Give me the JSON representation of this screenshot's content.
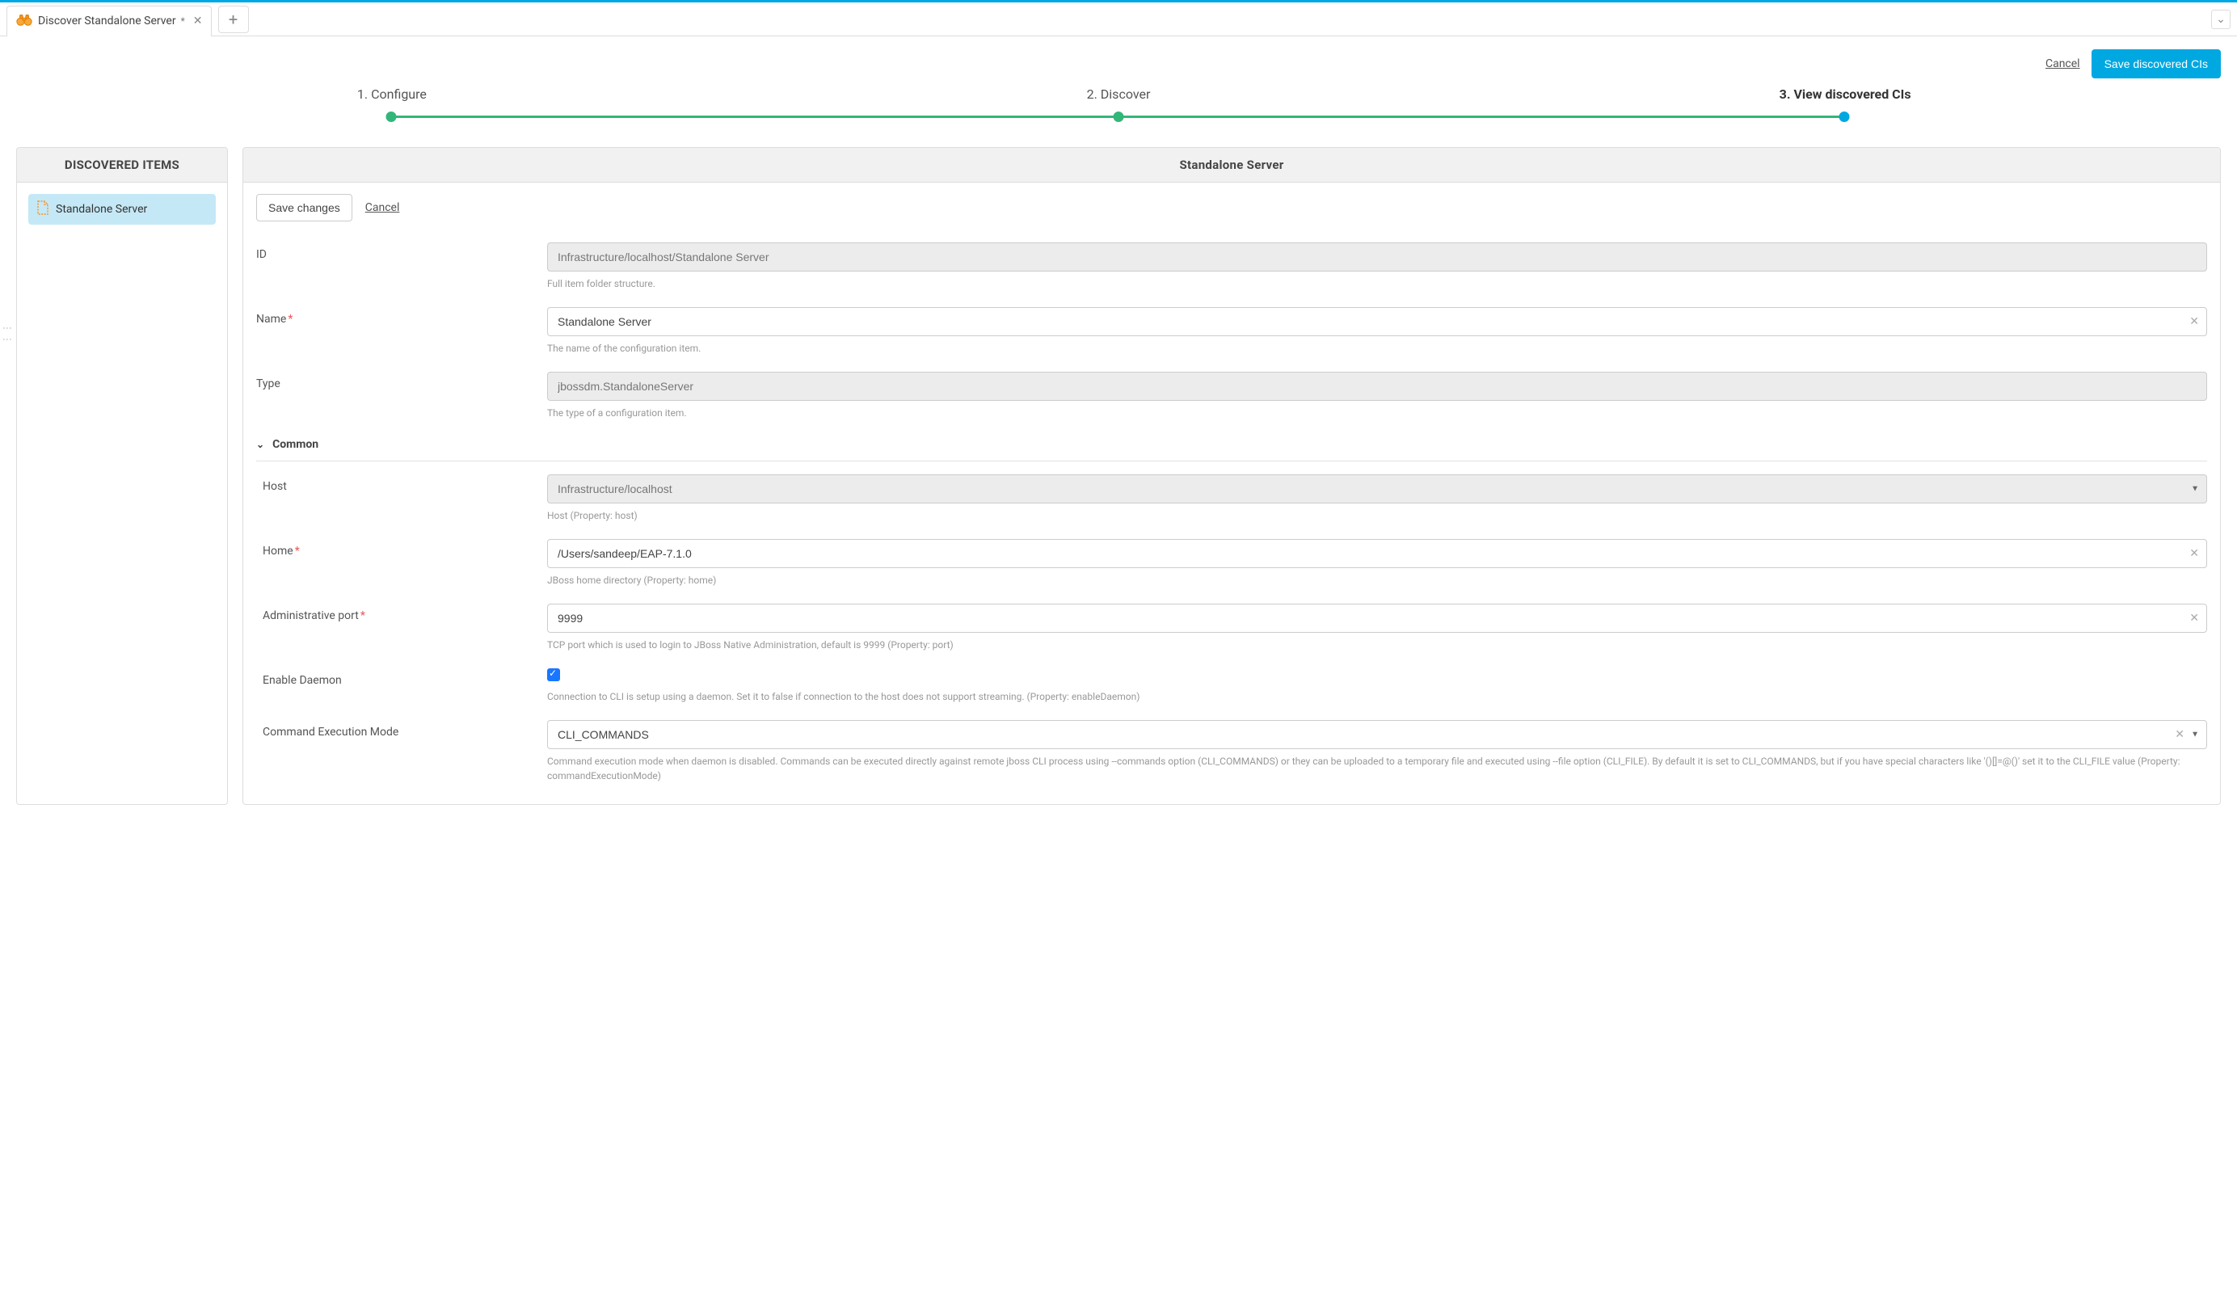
{
  "tab": {
    "title": "Discover Standalone Server",
    "dirty": "*"
  },
  "header": {
    "cancel": "Cancel",
    "save": "Save discovered CIs"
  },
  "stepper": {
    "step1": "1. Configure",
    "step2": "2. Discover",
    "step3": "3. View discovered CIs"
  },
  "sidebar": {
    "title": "DISCOVERED ITEMS",
    "item": "Standalone Server"
  },
  "panel": {
    "title": "Standalone Server",
    "save_changes": "Save changes",
    "cancel": "Cancel"
  },
  "form": {
    "id": {
      "label": "ID",
      "value": "Infrastructure/localhost/Standalone Server",
      "help": "Full item folder structure."
    },
    "name": {
      "label": "Name",
      "value": "Standalone Server",
      "help": "The name of the configuration item."
    },
    "type": {
      "label": "Type",
      "value": "jbossdm.StandaloneServer",
      "help": "The type of a configuration item."
    },
    "section_common": "Common",
    "host": {
      "label": "Host",
      "value": "Infrastructure/localhost",
      "help": "Host (Property: host)"
    },
    "home": {
      "label": "Home",
      "value": "/Users/sandeep/EAP-7.1.0",
      "help": "JBoss home directory (Property: home)"
    },
    "port": {
      "label": "Administrative port",
      "value": "9999",
      "help": "TCP port which is used to login to JBoss Native Administration, default is 9999 (Property: port)"
    },
    "daemon": {
      "label": "Enable Daemon",
      "help": "Connection to CLI is setup using a daemon. Set it to false if connection to the host does not support streaming. (Property: enableDaemon)"
    },
    "cmdmode": {
      "label": "Command Execution Mode",
      "value": "CLI_COMMANDS",
      "help": "Command execution mode when daemon is disabled. Commands can be executed directly against remote jboss CLI process using --commands option (CLI_COMMANDS) or they can be uploaded to a temporary file and executed using --file option (CLI_FILE). By default it is set to CLI_COMMANDS, but if you have special characters like '()[]=@()' set it to the CLI_FILE value (Property: commandExecutionMode)"
    }
  }
}
